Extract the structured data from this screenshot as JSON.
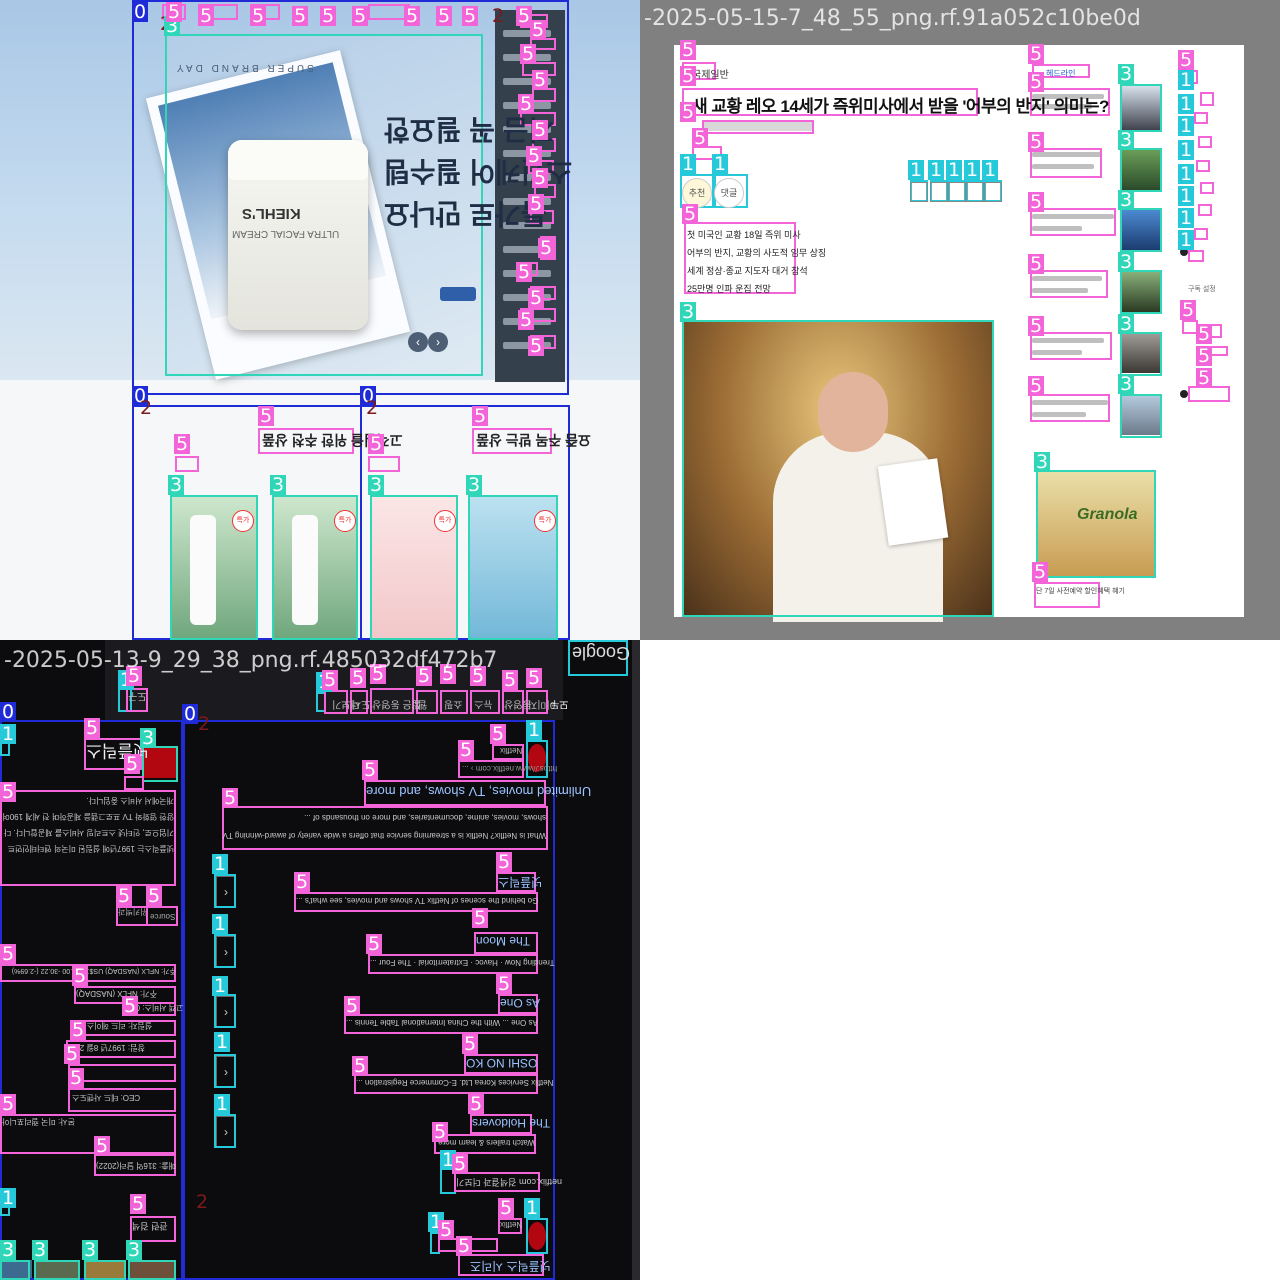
{
  "tiles": [
    {
      "title": "-2025-05-15-7_48_55_png.rf.91a052c10be0d"
    },
    {
      "title": "-2025-05-13-9_29_38_png.rf.485032df472b7"
    }
  ],
  "shopping": {
    "tagline": "SUPER BRAND DAY",
    "headline": [
      "지금 꼭 필요한",
      "스킨케어 필수템",
      "특가로 만나요"
    ],
    "jar_brand": "KIEHL'S",
    "jar_product": "ULTRA FACIAL CREAM",
    "promo1_title": "고객님을 위한 추천 상품",
    "promo2_title": "요즘 주목 받는 상품",
    "sale_badge": "특가"
  },
  "news": {
    "section": "국제일반",
    "headline": "새 교황 레오 14세가 즉위미사에서 받을 '어부의 반지' 의미는?",
    "summary": [
      "첫 미국인 교황 18일 즉위 미사",
      "어부의 반지, 교황의 사도적 임무 상징",
      "세계 정상·종교 지도자 대거 참석",
      "25만명 인파 운집 전망"
    ],
    "actions": [
      "추천",
      "댓글"
    ],
    "sidebar_heading": "헤드라인",
    "ad_caption": "단 7일 사전예약 할인혜택 혜기",
    "ad_brand": "Granola",
    "right_heading": "구독 설정"
  },
  "search": {
    "logo": "Google",
    "tabs": [
      "모두",
      "이미지",
      "동영상",
      "뉴스",
      "쇼핑",
      "웹",
      "짧은 동영상",
      "도서",
      "더보기",
      "도구"
    ],
    "kp_title": "넷플릭스",
    "kp_summary": "넷플릭스는 1997년에 설립된 미국의 엔터테인먼트 기업으로, 인터넷 스트리밍 서비스를 제공합니다. 다양한 영화와 TV 프로그램을 제공하며 전 세계 190여 개국에서 서비스 중입니다.",
    "kp_source": "위키백과",
    "kp_source_label": "Source",
    "kp_stock": "주가: NFLX (NASDAQ)  US$1,000.00 -30.22 (-2.69%)",
    "kp_facts": [
      "주가: NFLX (NASDAQ)",
      "고객 서비스: 080-",
      "설립자: 리드 헤이스팅스",
      "창립: 1997년 8월 29일",
      "CEO: 테드 사랜도스",
      "본사: 미국 캘리포니아",
      "매출: 316억 달러(2022)"
    ],
    "results": [
      {
        "site": "Netflix",
        "url": "https://www.netflix.com › ...",
        "title": "Unlimited movies, TV shows, and more",
        "snippet": "What is Netflix? Netflix is a streaming service that offers a wide variety of award-winning TV shows, movies, anime, documentaries, and more on thousands of ..."
      },
      {
        "title": "넷플릭스",
        "snippet": "Go behind the scenes of Netflix TV shows and movies, see what's ..."
      },
      {
        "title": "The Moon",
        "snippet": "Trending Now · Havoc · Extraterritorial · The Four ..."
      },
      {
        "title": "As One",
        "snippet": "As One ... With the China International Table Tennis ..."
      },
      {
        "title": "OSHI NO KO",
        "snippet": "Netflix Services Korea Ltd. E-Commerce Registration ..."
      },
      {
        "title": "The Holdovers",
        "snippet": "Watch trailers & learn more."
      }
    ],
    "more_results": "netflix.com 검색결과 더보기",
    "second_site": "Netflix",
    "second_title": "넷플릭스 시리즈",
    "related_heading": "관련 검색"
  }
}
